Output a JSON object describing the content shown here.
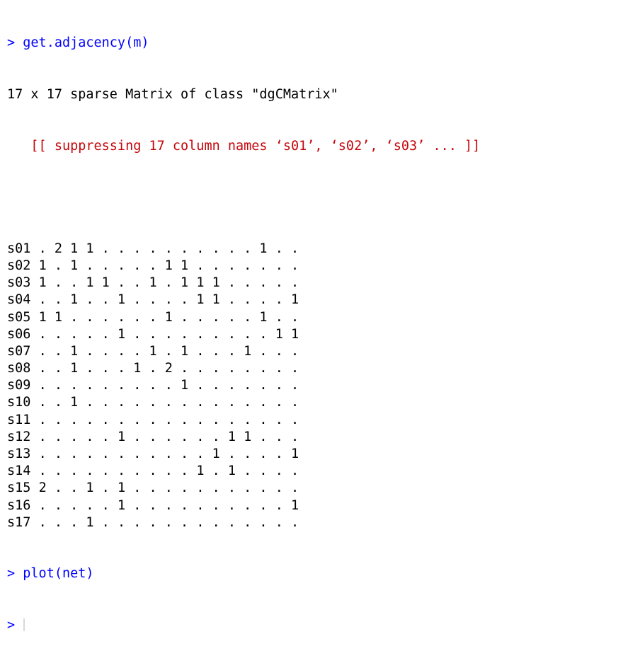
{
  "console": {
    "prompt": ">",
    "command1": "get.adjacency(m)",
    "header": "17 x 17 sparse Matrix of class \"dgCMatrix\"",
    "warning": "   [[ suppressing 17 column names ‘s01’, ‘s02’, ‘s03’ ... ]]",
    "matrix_rows": [
      {
        "label": "s01",
        "values": ". 2 1 1 . . . . . . . . . . 1 . ."
      },
      {
        "label": "s02",
        "values": "1 . 1 . . . . . 1 1 . . . . . . ."
      },
      {
        "label": "s03",
        "values": "1 . . 1 1 . . 1 . 1 1 1 . . . . ."
      },
      {
        "label": "s04",
        "values": ". . 1 . . 1 . . . . 1 1 . . . . 1"
      },
      {
        "label": "s05",
        "values": "1 1 . . . . . . 1 . . . . . 1 . ."
      },
      {
        "label": "s06",
        "values": ". . . . . 1 . . . . . . . . . 1 1"
      },
      {
        "label": "s07",
        "values": ". . 1 . . . . 1 . 1 . . . 1 . . ."
      },
      {
        "label": "s08",
        "values": ". . 1 . . . 1 . 2 . . . . . . . ."
      },
      {
        "label": "s09",
        "values": ". . . . . . . . . 1 . . . . . . ."
      },
      {
        "label": "s10",
        "values": ". . 1 . . . . . . . . . . . . . ."
      },
      {
        "label": "s11",
        "values": ". . . . . . . . . . . . . . . . ."
      },
      {
        "label": "s12",
        "values": ". . . . . 1 . . . . . . 1 1 . . ."
      },
      {
        "label": "s13",
        "values": ". . . . . . . . . . . 1 . . . . 1"
      },
      {
        "label": "s14",
        "values": ". . . . . . . . . . 1 . 1 . . . ."
      },
      {
        "label": "s15",
        "values": "2 . . 1 . 1 . . . . . . . . . . ."
      },
      {
        "label": "s16",
        "values": ". . . . . 1 . . . . . . . . . . 1"
      },
      {
        "label": "s17",
        "values": ". . . 1 . . . . . . . . . . . . ."
      }
    ],
    "command2": "plot(net)"
  }
}
